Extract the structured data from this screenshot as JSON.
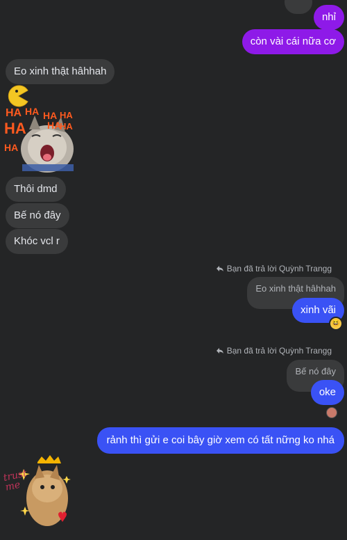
{
  "outgoing_top": [
    {
      "text": "nhỉ"
    },
    {
      "text": "còn vài cái nữa cơ"
    }
  ],
  "incoming": [
    {
      "text": "Eo xinh thật hâhhah"
    },
    {
      "text": "Thôi dmd"
    },
    {
      "text": "Bế nó đây"
    },
    {
      "text": "Khóc vcl r"
    }
  ],
  "sticker_haha": {
    "label": "HA"
  },
  "replies": [
    {
      "label": "Bạn đã trả lời Quỳnh Trangg",
      "quoted": "Eo xinh thật hâhhah",
      "message": "xinh vãi",
      "reaction": "😆"
    },
    {
      "label": "Bạn đã trả lời Quỳnh Trangg",
      "quoted": "Bế nó đây",
      "message": "oke"
    }
  ],
  "last_outgoing": {
    "text": "rảnh thì gửi e coi bây giờ xem có tất nững ko nhá"
  },
  "sticker_trust": {
    "text": "trust me"
  },
  "colors": {
    "purple": "#8e1ae8",
    "blue": "#3a52f5",
    "incoming": "#3a3b3c",
    "background": "#242526"
  }
}
